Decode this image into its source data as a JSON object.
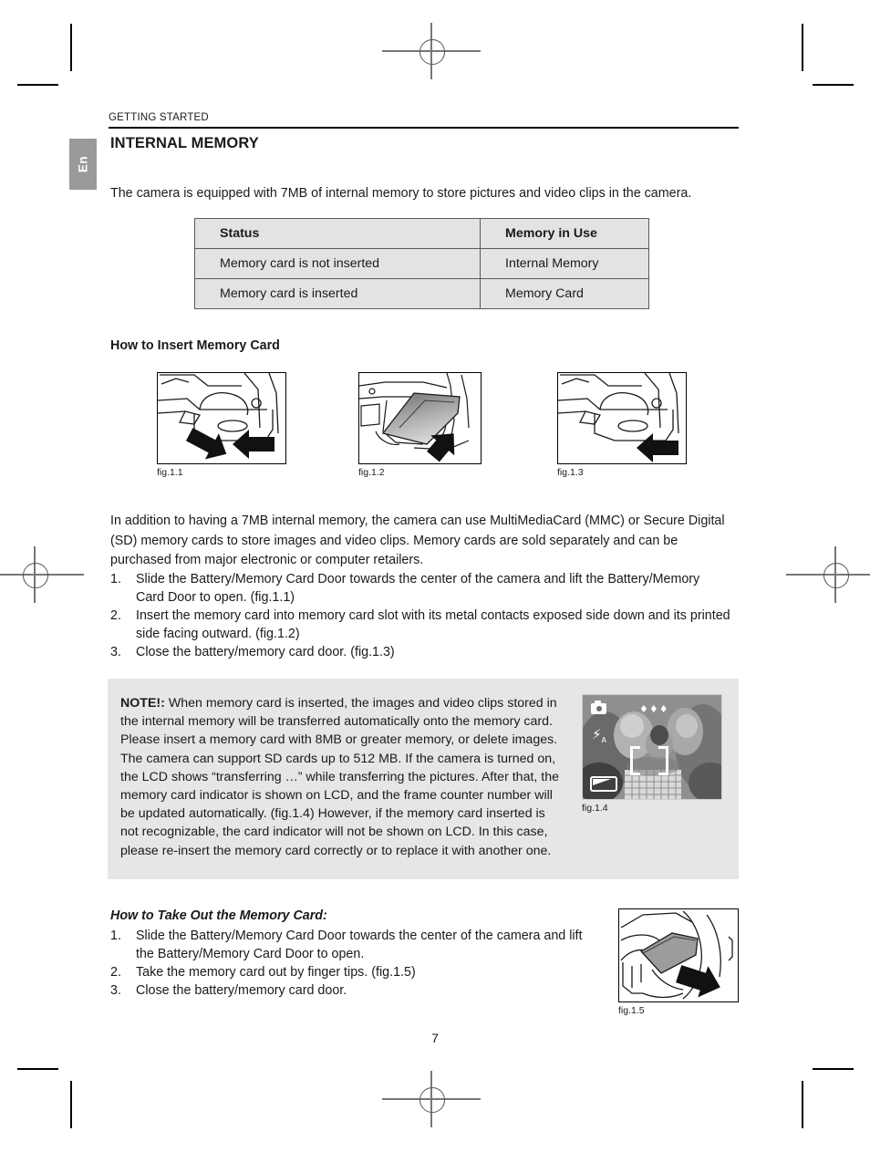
{
  "document": {
    "running_head": "GETTING STARTED",
    "language_tab": "En",
    "page_number": "7"
  },
  "section": {
    "title": "INTERNAL MEMORY",
    "intro": "The camera is equipped with 7MB of internal memory to store pictures and video clips in the camera."
  },
  "status_table": {
    "headers": [
      "Status",
      "Memory in Use"
    ],
    "rows": [
      [
        "Memory card is not inserted",
        "Internal Memory"
      ],
      [
        "Memory card is inserted",
        "Memory Card"
      ]
    ]
  },
  "insert_section": {
    "heading": "How to Insert Memory Card",
    "figures": [
      {
        "caption": "fig.1.1",
        "alt": "camera-door-slide-open"
      },
      {
        "caption": "fig.1.2",
        "alt": "memory-card-insert-slot"
      },
      {
        "caption": "fig.1.3",
        "alt": "camera-door-close"
      }
    ],
    "paragraph": "In addition to having a 7MB internal memory, the camera can use MultiMediaCard (MMC) or Secure Digital (SD) memory cards to store images and video clips.  Memory cards are sold separately and can be purchased from major electronic or computer retailers.",
    "steps": [
      {
        "num": "1.",
        "text": "Slide the Battery/Memory Card Door towards the center of the camera and lift the Battery/Memory Card Door to open. (fig.1.1)"
      },
      {
        "num": "2.",
        "text": "Insert the memory card into memory card slot with its metal contacts exposed side down and its printed side facing outward. (fig.1.2)"
      },
      {
        "num": "3.",
        "text": "Close the battery/memory card door. (fig.1.3)"
      }
    ]
  },
  "note": {
    "label": "NOTE!:",
    "body": "  When memory card is inserted, the images and video clips stored in the internal memory will be transferred automatically onto the memory card. Please insert a memory card with 8MB  or greater memory, or delete images. The camera can support SD cards up to 512 MB.  If the camera is turned on, the LCD shows “transferring …” while transferring the pictures. After that, the memory card indicator is shown on LCD, and the frame counter number will be updated automatically. (fig.1.4)  However, if the memory card inserted is not recognizable, the card indicator will not be shown on LCD. In this case, please re-insert the memory card correctly or to replace it with another one.",
    "figure": {
      "caption": "fig.1.4",
      "alt": "lcd-preview-screen",
      "icons": {
        "mode": "camera-icon",
        "quality": "♦♦♦",
        "flash": "flash-auto-icon",
        "focus": "focus-bracket-icon",
        "battery": "battery-icon"
      }
    }
  },
  "takeout_section": {
    "heading": "How to Take Out the Memory Card:",
    "steps": [
      {
        "num": "1.",
        "text": "Slide the Battery/Memory Card Door towards the center of the camera and lift the Battery/Memory Card Door to open."
      },
      {
        "num": "2.",
        "text": "Take the memory card out by finger tips. (fig.1.5)"
      },
      {
        "num": "3.",
        "text": "Close the battery/memory card door."
      }
    ],
    "figure": {
      "caption": "fig.1.5",
      "alt": "memory-card-removal-finger-tips"
    }
  },
  "colors": {
    "table_fill": "#e3e3e3",
    "note_fill": "#e6e6e6",
    "tab_fill": "#9a9a9a",
    "rule": "#000000"
  }
}
